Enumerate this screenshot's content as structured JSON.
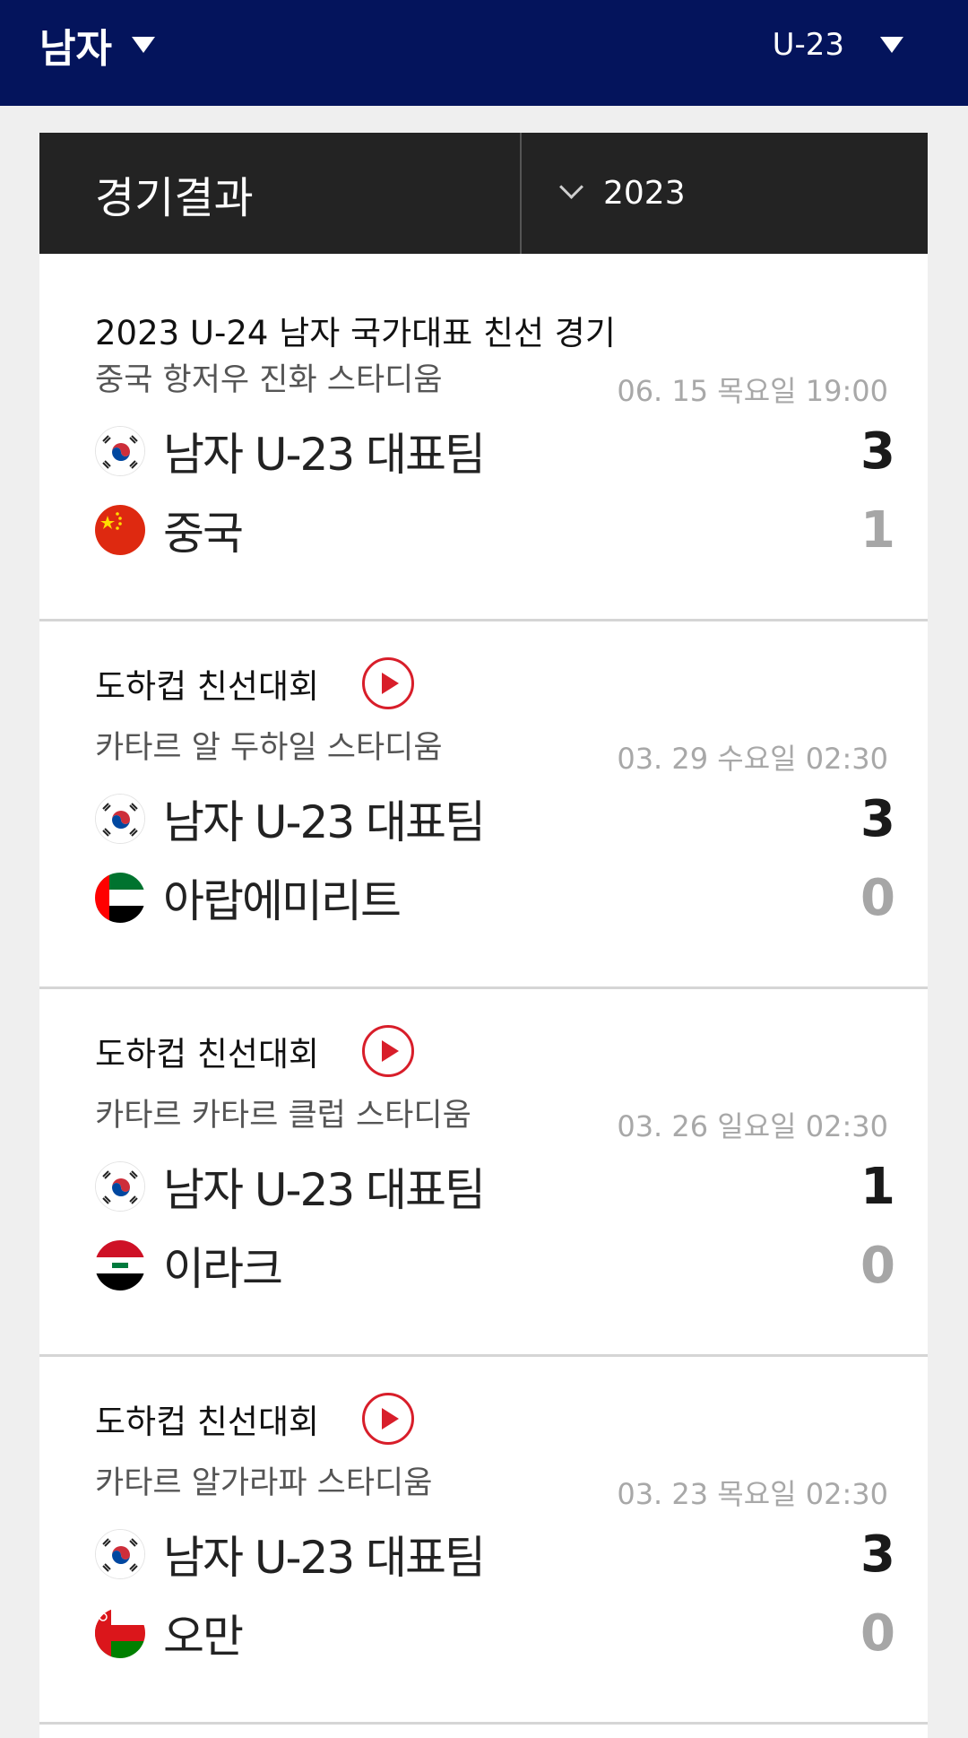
{
  "header": {
    "gender_label": "남자",
    "age_label": "U-23",
    "bg_color": "#04145c"
  },
  "results": {
    "title": "경기결과",
    "year": "2023"
  },
  "matches": [
    {
      "competition": "2023 U-24 남자 국가대표 친선 경기",
      "has_video": false,
      "venue": "중국 항저우 진화 스타디움",
      "datetime": "06. 15 목요일 19:00",
      "home": {
        "name": "남자 U-23 대표팀",
        "flag": "korea-flag-icon",
        "score": "3"
      },
      "away": {
        "name": "중국",
        "flag": "china-flag-icon",
        "score": "1"
      }
    },
    {
      "competition": "도하컵 친선대회",
      "has_video": true,
      "venue": "카타르 알 두하일 스타디움",
      "datetime": "03. 29 수요일 02:30",
      "home": {
        "name": "남자 U-23 대표팀",
        "flag": "korea-flag-icon",
        "score": "3"
      },
      "away": {
        "name": "아랍에미리트",
        "flag": "uae-flag-icon",
        "score": "0"
      }
    },
    {
      "competition": "도하컵 친선대회",
      "has_video": true,
      "venue": "카타르 카타르 클럽 스타디움",
      "datetime": "03. 26 일요일 02:30",
      "home": {
        "name": "남자 U-23 대표팀",
        "flag": "korea-flag-icon",
        "score": "1"
      },
      "away": {
        "name": "이라크",
        "flag": "iraq-flag-icon",
        "score": "0"
      }
    },
    {
      "competition": "도하컵 친선대회",
      "has_video": true,
      "venue": "카타르 알가라파 스타디움",
      "datetime": "03. 23 목요일 02:30",
      "home": {
        "name": "남자 U-23 대표팀",
        "flag": "korea-flag-icon",
        "score": "3"
      },
      "away": {
        "name": "오만",
        "flag": "oman-flag-icon",
        "score": "0"
      }
    }
  ]
}
